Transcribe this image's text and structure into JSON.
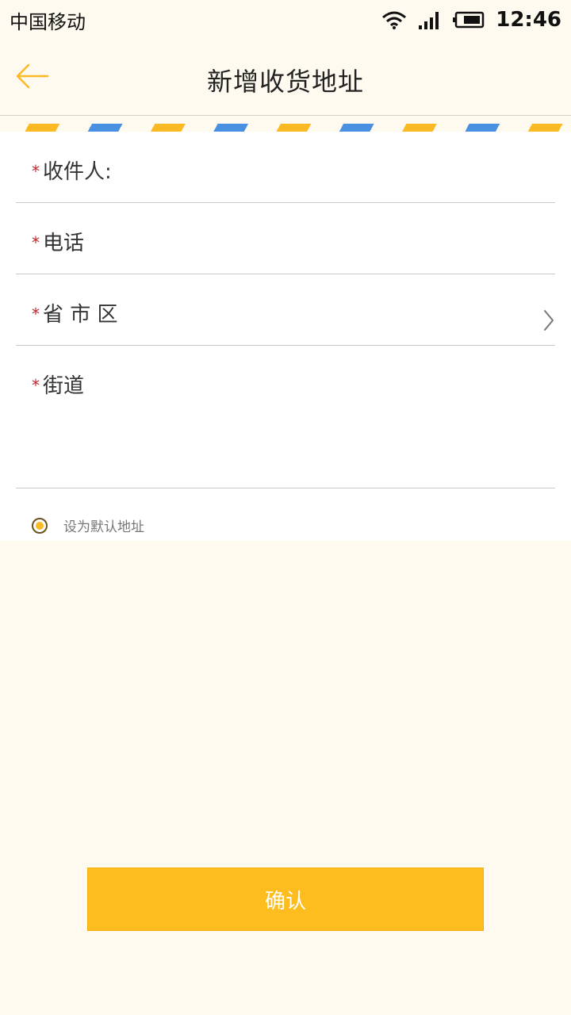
{
  "status_bar": {
    "carrier": "中国移动",
    "time": "12:46",
    "icons": [
      "wifi-icon",
      "signal-icon",
      "battery-icon"
    ]
  },
  "header": {
    "title": "新增收货地址",
    "back_icon": "arrow-left-icon"
  },
  "form": {
    "required_mark": "*",
    "fields": [
      {
        "label": "收件人:",
        "value": ""
      },
      {
        "label": "电话",
        "value": ""
      },
      {
        "label": "省 市 区",
        "value": "",
        "icon": "chevron-right-icon"
      },
      {
        "label": "街道",
        "value": ""
      }
    ],
    "default_option": {
      "label": "设为默认地址",
      "selected": true
    }
  },
  "confirm_label": "确认",
  "colors": {
    "accent": "#fbb924",
    "stripe_blue": "#4a90e2",
    "required": "#c0262b",
    "background": "#fffaef"
  }
}
